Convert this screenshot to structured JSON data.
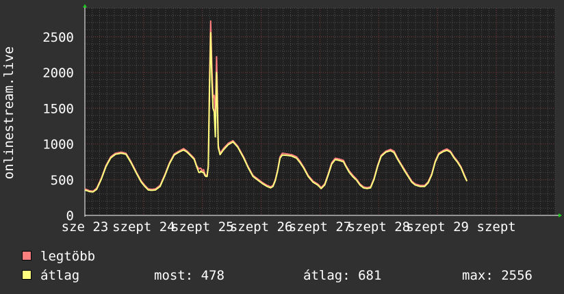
{
  "chart_data": {
    "type": "line",
    "ylabel": "onlinestream.live",
    "ylim": [
      0,
      2900
    ],
    "yticks": [
      0,
      500,
      1000,
      1500,
      2000,
      2500
    ],
    "xlim": [
      22.0,
      30.0
    ],
    "xticks": [
      {
        "x": 22.0,
        "label": "sze 23"
      },
      {
        "x": 23.0,
        "label": "szept 24"
      },
      {
        "x": 24.0,
        "label": "szept 25"
      },
      {
        "x": 25.0,
        "label": "szept 26"
      },
      {
        "x": 26.0,
        "label": "szept 27"
      },
      {
        "x": 27.0,
        "label": "szept 28"
      },
      {
        "x": 28.0,
        "label": "szept 29"
      },
      {
        "x": 29.0,
        "label": "szept"
      }
    ],
    "grid": true,
    "series": [
      {
        "name": "legtöbb",
        "color": "#ff7f7f",
        "points": [
          [
            22.0,
            370
          ],
          [
            22.04,
            360
          ],
          [
            22.08,
            345
          ],
          [
            22.14,
            340
          ],
          [
            22.2,
            380
          ],
          [
            22.28,
            520
          ],
          [
            22.36,
            700
          ],
          [
            22.44,
            820
          ],
          [
            22.52,
            870
          ],
          [
            22.62,
            885
          ],
          [
            22.7,
            870
          ],
          [
            22.78,
            760
          ],
          [
            22.88,
            600
          ],
          [
            22.96,
            480
          ],
          [
            23.02,
            420
          ],
          [
            23.08,
            370
          ],
          [
            23.14,
            365
          ],
          [
            23.2,
            370
          ],
          [
            23.28,
            420
          ],
          [
            23.36,
            570
          ],
          [
            23.44,
            740
          ],
          [
            23.52,
            860
          ],
          [
            23.6,
            900
          ],
          [
            23.68,
            935
          ],
          [
            23.74,
            900
          ],
          [
            23.8,
            850
          ],
          [
            23.86,
            800
          ],
          [
            23.9,
            700
          ],
          [
            23.94,
            650
          ],
          [
            23.96,
            660
          ],
          [
            23.97,
            660
          ],
          [
            24.0,
            620
          ],
          [
            24.02,
            640
          ],
          [
            24.04,
            580
          ],
          [
            24.06,
            560
          ],
          [
            24.08,
            560
          ],
          [
            24.1,
            700
          ],
          [
            24.12,
            1900
          ],
          [
            24.14,
            2720
          ],
          [
            24.16,
            2100
          ],
          [
            24.18,
            1650
          ],
          [
            24.2,
            1680
          ],
          [
            24.22,
            1350
          ],
          [
            24.24,
            2220
          ],
          [
            24.25,
            1900
          ],
          [
            24.27,
            980
          ],
          [
            24.3,
            870
          ],
          [
            24.36,
            940
          ],
          [
            24.44,
            1010
          ],
          [
            24.52,
            1045
          ],
          [
            24.6,
            970
          ],
          [
            24.7,
            820
          ],
          [
            24.78,
            680
          ],
          [
            24.86,
            560
          ],
          [
            24.94,
            510
          ],
          [
            25.02,
            460
          ],
          [
            25.1,
            420
          ],
          [
            25.16,
            400
          ],
          [
            25.2,
            420
          ],
          [
            25.24,
            500
          ],
          [
            25.28,
            640
          ],
          [
            25.32,
            820
          ],
          [
            25.36,
            870
          ],
          [
            25.44,
            860
          ],
          [
            25.52,
            850
          ],
          [
            25.6,
            820
          ],
          [
            25.66,
            760
          ],
          [
            25.72,
            680
          ],
          [
            25.8,
            560
          ],
          [
            25.88,
            480
          ],
          [
            25.96,
            440
          ],
          [
            26.02,
            390
          ],
          [
            26.08,
            440
          ],
          [
            26.14,
            580
          ],
          [
            26.2,
            740
          ],
          [
            26.26,
            800
          ],
          [
            26.32,
            790
          ],
          [
            26.4,
            770
          ],
          [
            26.44,
            700
          ],
          [
            26.5,
            620
          ],
          [
            26.56,
            560
          ],
          [
            26.62,
            510
          ],
          [
            26.68,
            440
          ],
          [
            26.74,
            400
          ],
          [
            26.8,
            390
          ],
          [
            26.86,
            400
          ],
          [
            26.92,
            520
          ],
          [
            26.98,
            700
          ],
          [
            27.04,
            840
          ],
          [
            27.12,
            900
          ],
          [
            27.2,
            925
          ],
          [
            27.26,
            900
          ],
          [
            27.32,
            800
          ],
          [
            27.38,
            720
          ],
          [
            27.44,
            640
          ],
          [
            27.5,
            560
          ],
          [
            27.56,
            480
          ],
          [
            27.62,
            440
          ],
          [
            27.7,
            420
          ],
          [
            27.78,
            420
          ],
          [
            27.84,
            470
          ],
          [
            27.9,
            580
          ],
          [
            27.96,
            760
          ],
          [
            28.02,
            870
          ],
          [
            28.1,
            910
          ],
          [
            28.16,
            930
          ],
          [
            28.22,
            900
          ],
          [
            28.28,
            820
          ],
          [
            28.34,
            760
          ],
          [
            28.4,
            680
          ],
          [
            28.46,
            560
          ],
          [
            28.5,
            480
          ]
        ]
      },
      {
        "name": "átlag",
        "color": "#ffff7f",
        "points": [
          [
            22.0,
            355
          ],
          [
            22.04,
            345
          ],
          [
            22.08,
            332
          ],
          [
            22.14,
            328
          ],
          [
            22.2,
            365
          ],
          [
            22.28,
            505
          ],
          [
            22.36,
            685
          ],
          [
            22.44,
            805
          ],
          [
            22.52,
            855
          ],
          [
            22.62,
            870
          ],
          [
            22.7,
            855
          ],
          [
            22.78,
            745
          ],
          [
            22.88,
            585
          ],
          [
            22.96,
            465
          ],
          [
            23.02,
            405
          ],
          [
            23.08,
            355
          ],
          [
            23.14,
            350
          ],
          [
            23.2,
            355
          ],
          [
            23.28,
            405
          ],
          [
            23.36,
            555
          ],
          [
            23.44,
            725
          ],
          [
            23.52,
            845
          ],
          [
            23.6,
            885
          ],
          [
            23.68,
            915
          ],
          [
            23.74,
            885
          ],
          [
            23.8,
            835
          ],
          [
            23.86,
            785
          ],
          [
            23.9,
            685
          ],
          [
            23.94,
            600
          ],
          [
            23.96,
            600
          ],
          [
            23.97,
            620
          ],
          [
            24.0,
            600
          ],
          [
            24.02,
            600
          ],
          [
            24.04,
            560
          ],
          [
            24.06,
            545
          ],
          [
            24.08,
            545
          ],
          [
            24.1,
            680
          ],
          [
            24.12,
            1750
          ],
          [
            24.14,
            2556
          ],
          [
            24.16,
            1900
          ],
          [
            24.18,
            1500
          ],
          [
            24.2,
            1450
          ],
          [
            24.22,
            1100
          ],
          [
            24.24,
            2000
          ],
          [
            24.25,
            1700
          ],
          [
            24.27,
            950
          ],
          [
            24.3,
            850
          ],
          [
            24.36,
            920
          ],
          [
            24.44,
            990
          ],
          [
            24.52,
            1030
          ],
          [
            24.6,
            955
          ],
          [
            24.7,
            805
          ],
          [
            24.78,
            665
          ],
          [
            24.86,
            545
          ],
          [
            24.94,
            495
          ],
          [
            25.02,
            445
          ],
          [
            25.1,
            405
          ],
          [
            25.16,
            385
          ],
          [
            25.2,
            405
          ],
          [
            25.24,
            485
          ],
          [
            25.28,
            625
          ],
          [
            25.32,
            800
          ],
          [
            25.36,
            845
          ],
          [
            25.44,
            840
          ],
          [
            25.52,
            830
          ],
          [
            25.6,
            800
          ],
          [
            25.66,
            740
          ],
          [
            25.72,
            665
          ],
          [
            25.8,
            545
          ],
          [
            25.88,
            465
          ],
          [
            25.96,
            425
          ],
          [
            26.02,
            375
          ],
          [
            26.08,
            425
          ],
          [
            26.14,
            565
          ],
          [
            26.2,
            720
          ],
          [
            26.26,
            780
          ],
          [
            26.32,
            770
          ],
          [
            26.4,
            750
          ],
          [
            26.44,
            685
          ],
          [
            26.5,
            600
          ],
          [
            26.56,
            540
          ],
          [
            26.62,
            495
          ],
          [
            26.68,
            425
          ],
          [
            26.74,
            385
          ],
          [
            26.8,
            375
          ],
          [
            26.86,
            385
          ],
          [
            26.92,
            505
          ],
          [
            26.98,
            685
          ],
          [
            27.04,
            825
          ],
          [
            27.12,
            885
          ],
          [
            27.2,
            905
          ],
          [
            27.26,
            880
          ],
          [
            27.32,
            785
          ],
          [
            27.38,
            705
          ],
          [
            27.44,
            620
          ],
          [
            27.5,
            545
          ],
          [
            27.56,
            465
          ],
          [
            27.62,
            425
          ],
          [
            27.7,
            405
          ],
          [
            27.78,
            405
          ],
          [
            27.84,
            455
          ],
          [
            27.9,
            565
          ],
          [
            27.96,
            745
          ],
          [
            28.02,
            855
          ],
          [
            28.1,
            895
          ],
          [
            28.16,
            910
          ],
          [
            28.22,
            885
          ],
          [
            28.28,
            805
          ],
          [
            28.34,
            745
          ],
          [
            28.4,
            665
          ],
          [
            28.46,
            545
          ],
          [
            28.5,
            478
          ]
        ]
      }
    ]
  },
  "legend": [
    {
      "label": "legtöbb",
      "color": "#ff7f7f"
    },
    {
      "label": "átlag",
      "color": "#ffff7f"
    }
  ],
  "stats": {
    "most": "most: 478",
    "atlag": "átlag: 681",
    "max": "max: 2556"
  }
}
